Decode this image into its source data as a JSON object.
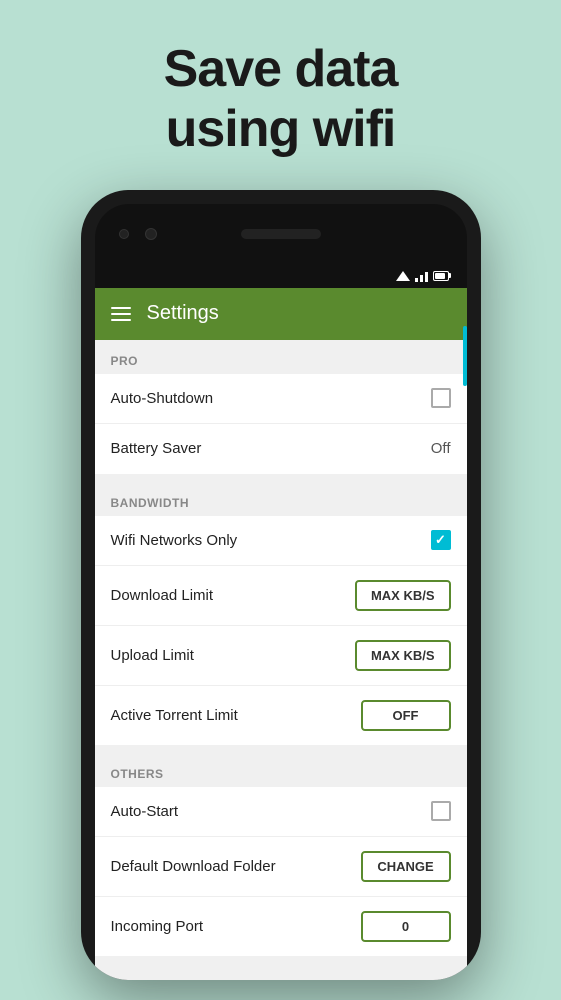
{
  "hero": {
    "line1": "Save data",
    "line2": "using wifi"
  },
  "appBar": {
    "title": "Settings"
  },
  "sections": [
    {
      "id": "pro",
      "label": "PRO",
      "rows": [
        {
          "id": "auto-shutdown",
          "label": "Auto-Shutdown",
          "controlType": "checkbox",
          "checked": false
        },
        {
          "id": "battery-saver",
          "label": "Battery Saver",
          "controlType": "value",
          "value": "Off"
        }
      ]
    },
    {
      "id": "bandwidth",
      "label": "BANDWIDTH",
      "rows": [
        {
          "id": "wifi-networks-only",
          "label": "Wifi Networks Only",
          "controlType": "checkbox",
          "checked": true
        },
        {
          "id": "download-limit",
          "label": "Download Limit",
          "controlType": "button",
          "buttonLabel": "MAX KB/S"
        },
        {
          "id": "upload-limit",
          "label": "Upload Limit",
          "controlType": "button",
          "buttonLabel": "MAX KB/S"
        },
        {
          "id": "active-torrent-limit",
          "label": "Active Torrent Limit",
          "controlType": "button",
          "buttonLabel": "OFF"
        }
      ]
    },
    {
      "id": "others",
      "label": "OTHERS",
      "rows": [
        {
          "id": "auto-start",
          "label": "Auto-Start",
          "controlType": "checkbox",
          "checked": false
        },
        {
          "id": "default-download-folder",
          "label": "Default Download Folder",
          "controlType": "button",
          "buttonLabel": "CHANGE"
        },
        {
          "id": "incoming-port",
          "label": "Incoming Port",
          "controlType": "button",
          "buttonLabel": "0"
        }
      ]
    }
  ],
  "statusBar": {
    "wifi": true,
    "signal": 3,
    "battery": 70
  }
}
